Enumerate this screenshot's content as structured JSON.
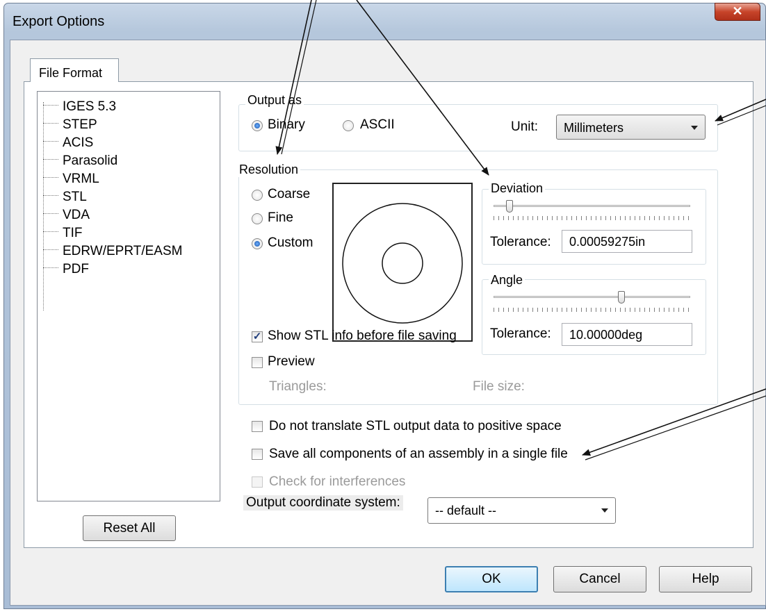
{
  "window": {
    "title": "Export Options",
    "close_glyph": "✕"
  },
  "tabs": [
    {
      "label": "File Format"
    }
  ],
  "formats": [
    "IGES 5.3",
    "STEP",
    "ACIS",
    "Parasolid",
    "VRML",
    "STL",
    "VDA",
    "TIF",
    "EDRW/EPRT/EASM",
    "PDF"
  ],
  "left": {
    "reset_label": "Reset All"
  },
  "output": {
    "legend": "Output as",
    "binary_label": "Binary",
    "ascii_label": "ASCII",
    "selected": "Binary",
    "unit_label": "Unit:",
    "unit_value": "Millimeters"
  },
  "resolution": {
    "legend": "Resolution",
    "coarse_label": "Coarse",
    "fine_label": "Fine",
    "custom_label": "Custom",
    "selected": "Custom",
    "deviation": {
      "legend": "Deviation",
      "tolerance_label": "Tolerance:",
      "tolerance_value": "0.00059275in",
      "slider_fraction": 0.08
    },
    "angle": {
      "legend": "Angle",
      "tolerance_label": "Tolerance:",
      "tolerance_value": "10.00000deg",
      "slider_fraction": 0.65
    },
    "show_info_label": "Show STL info before file saving",
    "show_info_checked": true,
    "preview_label": "Preview",
    "preview_checked": false,
    "triangles_label": "Triangles:",
    "filesize_label": "File size:"
  },
  "options": {
    "no_translate_label": "Do not translate STL output data to positive space",
    "no_translate_checked": false,
    "save_all_label": "Save all components of an assembly in a single file",
    "save_all_checked": false,
    "interference_label": "Check for interferences",
    "interference_checked": false,
    "coord_label": "Output coordinate system:",
    "coord_value": "-- default --"
  },
  "buttons": {
    "ok": "OK",
    "cancel": "Cancel",
    "help": "Help"
  },
  "colors": {
    "title_bar": "#b5c7dc",
    "close_button": "#c7442a",
    "focus_border": "#3c7fb1"
  }
}
